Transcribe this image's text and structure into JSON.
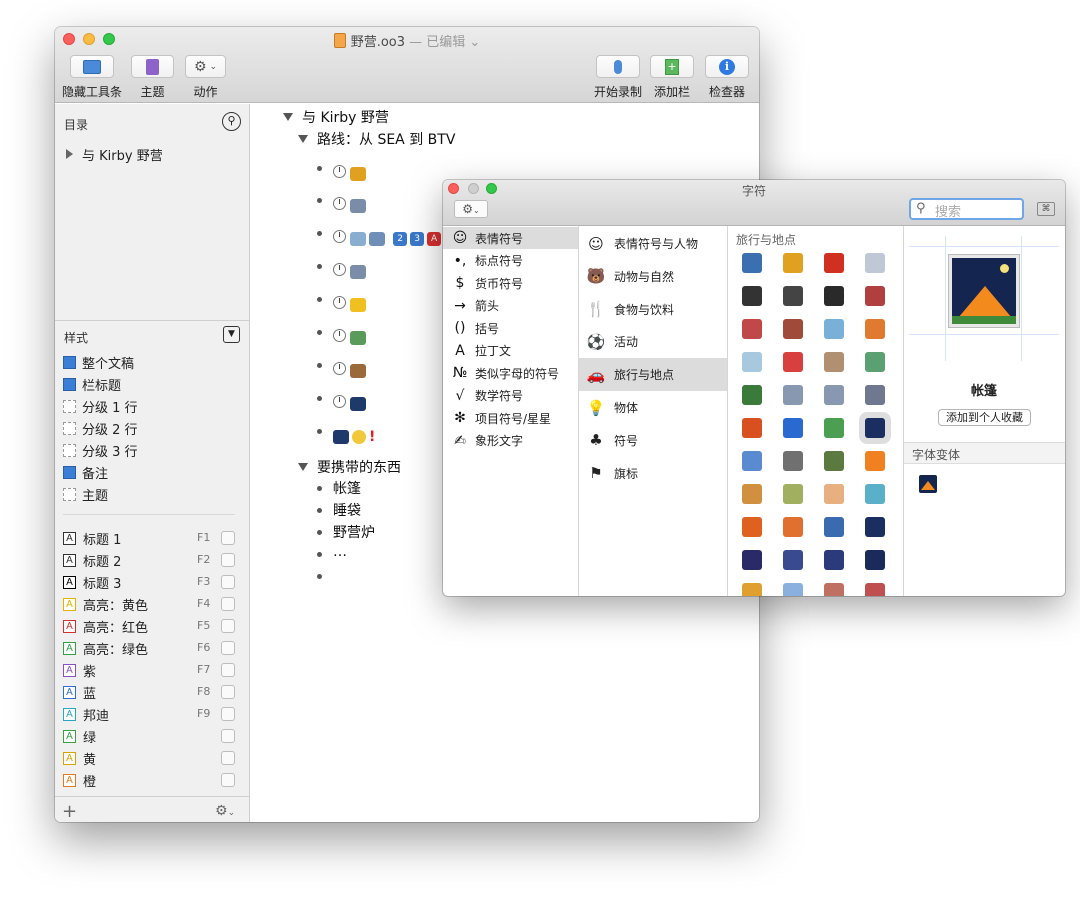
{
  "main_window": {
    "title": "野营.oo3",
    "title_status": "— 已编辑",
    "toolbar": {
      "hide_toolbar": "隐藏工具条",
      "theme": "主题",
      "action": "动作",
      "start_recording": "开始录制",
      "add_column": "添加栏",
      "inspector": "检查器"
    },
    "sidebar": {
      "contents_header": "目录",
      "contents_item": "与 Kirby 野营",
      "styles_header": "样式",
      "doc_styles": [
        {
          "label": "整个文稿",
          "swatch": "blue"
        },
        {
          "label": "栏标题",
          "swatch": "blue"
        },
        {
          "label": "分级 1 行",
          "swatch": "dashed"
        },
        {
          "label": "分级 2 行",
          "swatch": "dashed"
        },
        {
          "label": "分级 3 行",
          "swatch": "dashed"
        },
        {
          "label": "备注",
          "swatch": "blue"
        },
        {
          "label": "主题",
          "swatch": "dashed"
        }
      ],
      "named_styles": [
        {
          "label": "标题 1",
          "key": "F1",
          "color": "#333333"
        },
        {
          "label": "标题 2",
          "key": "F2",
          "color": "#333333"
        },
        {
          "label": "标题 3",
          "key": "F3",
          "color": "#000000"
        },
        {
          "label": "高亮：黄色",
          "key": "F4",
          "color": "#e0b400"
        },
        {
          "label": "高亮：红色",
          "key": "F5",
          "color": "#d03030"
        },
        {
          "label": "高亮：绿色",
          "key": "F6",
          "color": "#30a040"
        },
        {
          "label": "紫",
          "key": "F7",
          "color": "#8a4fc0"
        },
        {
          "label": "蓝",
          "key": "F8",
          "color": "#2f6fd0"
        },
        {
          "label": "邦迪",
          "key": "F9",
          "color": "#2aa6c0"
        },
        {
          "label": "绿",
          "key": "",
          "color": "#3aa040"
        },
        {
          "label": "黄",
          "key": "",
          "color": "#d6a400"
        },
        {
          "label": "橙",
          "key": "",
          "color": "#e07a20"
        }
      ]
    },
    "outline": {
      "root": "与 Kirby 野营",
      "route": "路线：从 SEA 到 BTV",
      "badges": [
        "2",
        "3",
        "A"
      ],
      "packing": "要携带的东西",
      "items": [
        "帐篷",
        "睡袋",
        "野营炉",
        "…"
      ]
    }
  },
  "char_window": {
    "title": "字符",
    "search_placeholder": "搜索",
    "categories": [
      {
        "glyph": "☺",
        "label": "表情符号"
      },
      {
        "glyph": "•,",
        "label": "标点符号"
      },
      {
        "glyph": "$",
        "label": "货币符号"
      },
      {
        "glyph": "→",
        "label": "箭头"
      },
      {
        "glyph": "()",
        "label": "括号"
      },
      {
        "glyph": "A",
        "label": "拉丁文"
      },
      {
        "glyph": "№",
        "label": "类似字母的符号"
      },
      {
        "glyph": "√",
        "label": "数学符号"
      },
      {
        "glyph": "✻",
        "label": "项目符号/星星"
      },
      {
        "glyph": "✍",
        "label": "象形文字"
      }
    ],
    "subcategories": [
      {
        "glyph": "☺",
        "label": "表情符号与人物"
      },
      {
        "glyph": "🐻",
        "label": "动物与自然"
      },
      {
        "glyph": "🍴",
        "label": "食物与饮料"
      },
      {
        "glyph": "⚽",
        "label": "活动"
      },
      {
        "glyph": "🚗",
        "label": "旅行与地点"
      },
      {
        "glyph": "💡",
        "label": "物体"
      },
      {
        "glyph": "♣",
        "label": "符号"
      },
      {
        "glyph": "⚑",
        "label": "旗标"
      }
    ],
    "grid_header": "旅行与地点",
    "selected_name": "帐篷",
    "add_favorite": "添加到个人收藏",
    "font_variants": "字体变体"
  }
}
